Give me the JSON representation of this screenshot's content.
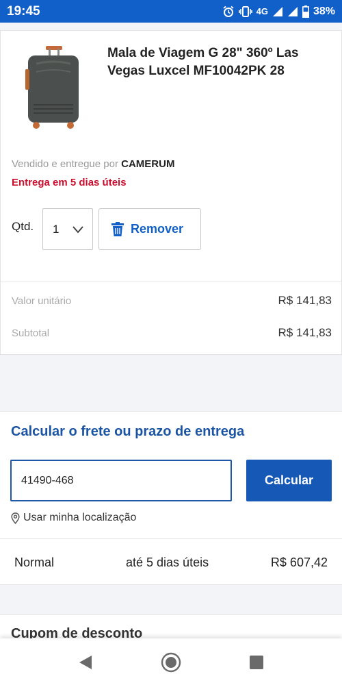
{
  "status": {
    "time": "19:45",
    "network": "4G",
    "battery": "38%"
  },
  "product": {
    "title": "Mala de Viagem G 28\" 360º Las Vegas Luxcel MF10042PK 28",
    "seller_prefix": "Vendido e entregue por",
    "seller_name": "CAMERUM",
    "delivery": "Entrega em 5 dias úteis",
    "qty_label": "Qtd.",
    "qty_value": "1",
    "remove_label": "Remover",
    "unit_price_label": "Valor unitário",
    "unit_price": "R$ 141,83",
    "subtotal_label": "Subtotal",
    "subtotal": "R$ 141,83"
  },
  "shipping": {
    "title": "Calcular o frete ou prazo de entrega",
    "cep_value": "41490-468",
    "calc_label": "Calcular",
    "use_location": "Usar minha localização",
    "option": {
      "name": "Normal",
      "time": "até 5 dias úteis",
      "price": "R$ 607,42"
    }
  },
  "coupon": {
    "title": "Cupom de desconto"
  },
  "colors": {
    "status_bar": "#1160c9",
    "brand_blue": "#1658b6",
    "delivery_red": "#c8102e"
  },
  "icons": [
    "alarm-icon",
    "vibrate-icon",
    "signal-icon",
    "battery-icon",
    "trash-icon",
    "chevron-down-icon",
    "location-pin-icon",
    "back-icon",
    "home-icon",
    "recents-icon"
  ]
}
